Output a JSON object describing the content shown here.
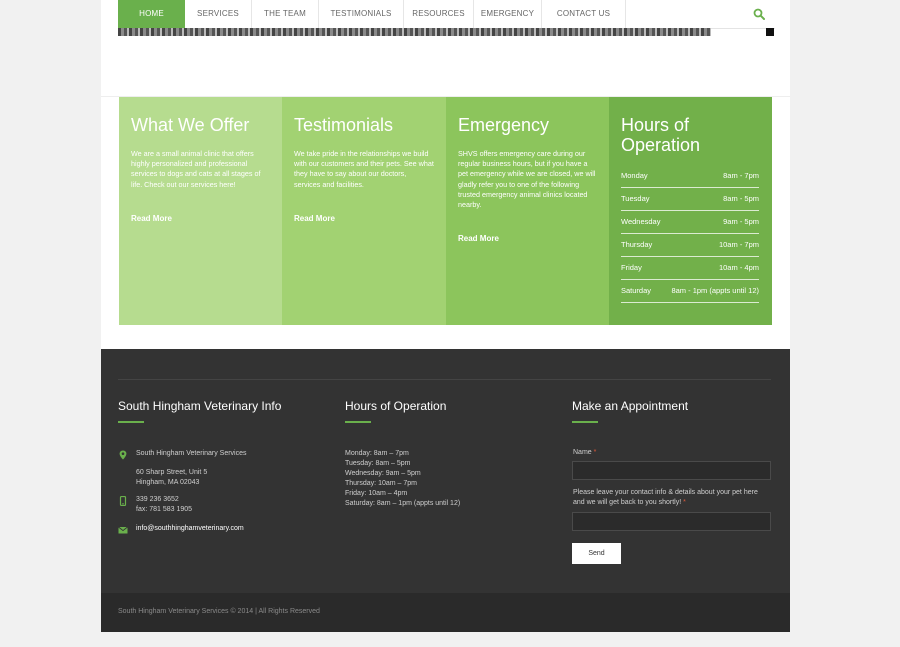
{
  "nav": {
    "items": [
      {
        "label": "HOME",
        "active": true
      },
      {
        "label": "SERVICES",
        "active": false
      },
      {
        "label": "THE TEAM",
        "active": false
      },
      {
        "label": "TESTIMONIALS",
        "active": false
      },
      {
        "label": "RESOURCES",
        "active": false
      },
      {
        "label": "EMERGENCY",
        "active": false
      },
      {
        "label": "CONTACT US",
        "active": false
      }
    ],
    "search_icon": "search-icon"
  },
  "features": {
    "offer": {
      "title": "What We Offer",
      "text": "We are a small animal clinic that offers highly personalized and professional services to dogs and cats at all stages of life. Check out our services here!",
      "link": "Read More",
      "color": "#b6dc8f"
    },
    "testimonials": {
      "title": "Testimonials",
      "text": "We take pride in the relationships we build with our customers and their pets. See what they have to say about our doctors, services and facilities.",
      "link": "Read More",
      "color": "#a2d272"
    },
    "emergency": {
      "title": "Emergency",
      "text": "SHVS offers emergency care during our regular business hours, but if you have a pet emergency while we are closed, we will gladly refer you to one of the following trusted emergency animal clinics located nearby.",
      "link": "Read More",
      "color": "#8cc55c"
    },
    "hours": {
      "title_line1": "Hours of",
      "title_line2": "Operation",
      "color": "#72b04a",
      "rows": [
        {
          "day": "Monday",
          "time": "8am - 7pm"
        },
        {
          "day": "Tuesday",
          "time": "8am - 5pm"
        },
        {
          "day": "Wednesday",
          "time": "9am - 5pm"
        },
        {
          "day": "Thursday",
          "time": "10am - 7pm"
        },
        {
          "day": "Friday",
          "time": "10am - 4pm"
        },
        {
          "day": "Saturday",
          "time": "8am - 1pm (appts until 12)"
        }
      ]
    }
  },
  "footer": {
    "info": {
      "title": "South Hingham Veterinary Info",
      "name": "South Hingham Veterinary Services",
      "address1": "60 Sharp Street, Unit 5",
      "address2": "Hingham, MA 02043",
      "phone": "339 236 3652",
      "fax": "fax: 781 583 1905",
      "email": "info@southhinghamveterinary.com"
    },
    "hours": {
      "title": "Hours of Operation",
      "lines": [
        "Monday: 8am – 7pm",
        "Tuesday: 8am – 5pm",
        "Wednesday: 9am – 5pm",
        "Thursday: 10am – 7pm",
        "Friday: 10am – 4pm",
        "Saturday: 8am – 1pm (appts until 12)"
      ]
    },
    "appointment": {
      "title": "Make an Appointment",
      "name_label": "Name",
      "message_label_line1": "Please leave your contact info & details about your pet here",
      "message_label_line2": "and we will get back to you shortly!",
      "required_mark": "*",
      "send_label": "Send"
    },
    "copyright": "South Hingham Veterinary Services © 2014 | All Rights Reserved"
  },
  "colors": {
    "accent": "#6ab04c",
    "footer_bg": "#333333"
  }
}
